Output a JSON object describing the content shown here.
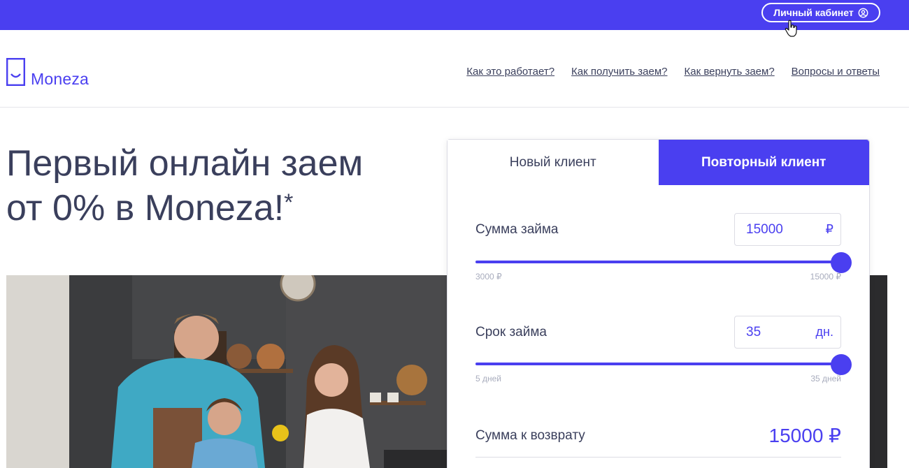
{
  "topbar": {
    "cabinet_label": "Личный кабинет",
    "icon": "user-circle-icon"
  },
  "header": {
    "logo_text": "Moneza",
    "nav": [
      {
        "label": "Как это работает?"
      },
      {
        "label": "Как получить заем?"
      },
      {
        "label": "Как вернуть заем?"
      },
      {
        "label": "Вопросы и ответы"
      }
    ]
  },
  "hero": {
    "title_line1": "Первый онлайн заем",
    "title_line2": "от 0% в Moneza!",
    "title_star": "*"
  },
  "calculator": {
    "tabs": [
      {
        "label": "Новый клиент",
        "active": false
      },
      {
        "label": "Повторный клиент",
        "active": true
      }
    ],
    "amount": {
      "label": "Сумма займа",
      "value": "15000",
      "unit": "₽",
      "min_label": "3000 ₽",
      "max_label": "15000 ₽",
      "fraction": 1.0
    },
    "term": {
      "label": "Срок займа",
      "value": "35",
      "unit": "дн.",
      "min_label": "5 дней",
      "max_label": "35 дней",
      "fraction": 1.0
    },
    "return": {
      "label": "Сумма к возврату",
      "value": "15000 ₽"
    }
  },
  "colors": {
    "accent": "#4a3ff0",
    "text": "#3a3f5c",
    "muted": "#a8acbd"
  }
}
